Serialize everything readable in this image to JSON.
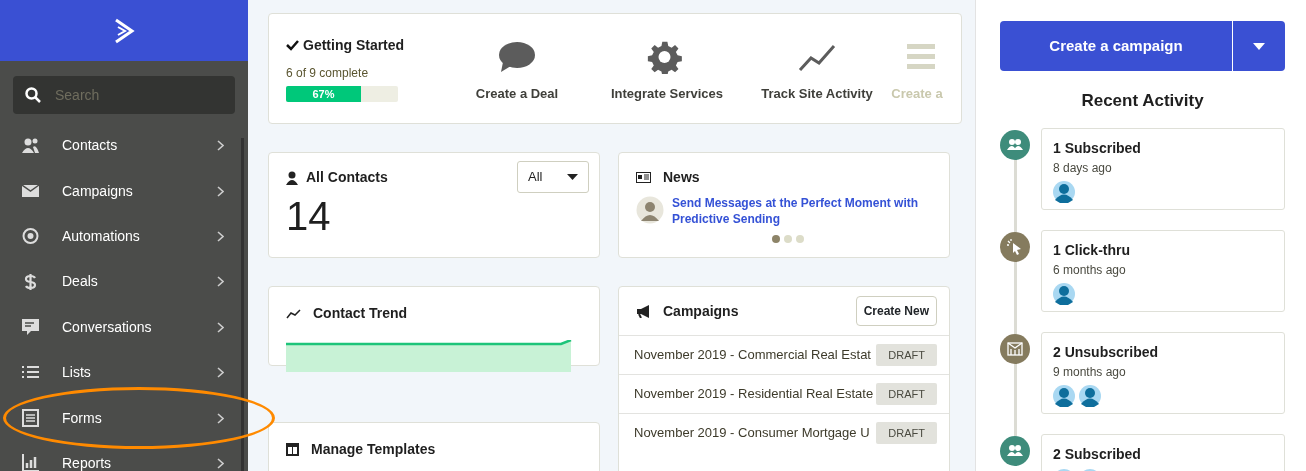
{
  "sidebar": {
    "search": {
      "placeholder": "Search"
    },
    "items": [
      {
        "label": "Contacts",
        "highlighted": false
      },
      {
        "label": "Campaigns",
        "highlighted": false
      },
      {
        "label": "Automations",
        "highlighted": false
      },
      {
        "label": "Deals",
        "highlighted": false
      },
      {
        "label": "Conversations",
        "highlighted": false
      },
      {
        "label": "Lists",
        "highlighted": false
      },
      {
        "label": "Forms",
        "highlighted": true
      },
      {
        "label": "Reports",
        "highlighted": false
      }
    ]
  },
  "getting_started": {
    "title": "Getting Started",
    "progress_text": "6 of 9 complete",
    "level": 0.67,
    "percent": "67%",
    "steps": [
      {
        "label": "Create a Deal",
        "kind": "chat",
        "disabled": false
      },
      {
        "label": "Integrate Services",
        "kind": "gear",
        "disabled": false
      },
      {
        "label": "Track Site Activity",
        "kind": "trend",
        "disabled": false
      },
      {
        "label": "Create a",
        "kind": "list",
        "disabled": true
      }
    ]
  },
  "all_contacts": {
    "title": "All Contacts",
    "count": "14",
    "filter": "All"
  },
  "news": {
    "title": "News",
    "headline": "Send Messages at the Perfect Moment with Predictive Sending",
    "dots": [
      {
        "selected": true
      },
      {
        "selected": false
      },
      {
        "selected": false
      }
    ]
  },
  "contact_trend": {
    "title": "Contact Trend"
  },
  "campaigns": {
    "title": "Campaigns",
    "button": "Create New",
    "rows": [
      {
        "name": "November 2019 - Commercial Real Estat",
        "status": "DRAFT"
      },
      {
        "name": "November 2019 - Residential Real Estate",
        "status": "DRAFT"
      },
      {
        "name": "November 2019 - Consumer Mortgage U",
        "status": "DRAFT"
      }
    ]
  },
  "manage_templates": {
    "title": "Manage Templates"
  },
  "right_panel": {
    "create_button": "Create a campaign",
    "heading": "Recent Activity",
    "activities": [
      {
        "title": "1 Subscribed",
        "time": "8 days ago",
        "color": "#3e8c7b",
        "kind": "people",
        "avatars": [
          {
            "kind": "person"
          }
        ]
      },
      {
        "title": "1 Click-thru",
        "time": "6 months ago",
        "color": "#857b5e",
        "kind": "click",
        "avatars": [
          {
            "kind": "person"
          }
        ]
      },
      {
        "title": "2 Unsubscribed",
        "time": "9 months ago",
        "color": "#857b5e",
        "kind": "unsub",
        "avatars": [
          {
            "kind": "person"
          },
          {
            "kind": "person"
          }
        ]
      },
      {
        "title": "2 Subscribed",
        "color": "#3e8c7b",
        "kind": "people",
        "avatars": [
          {
            "kind": "person"
          },
          {
            "kind": "person"
          }
        ]
      }
    ]
  }
}
